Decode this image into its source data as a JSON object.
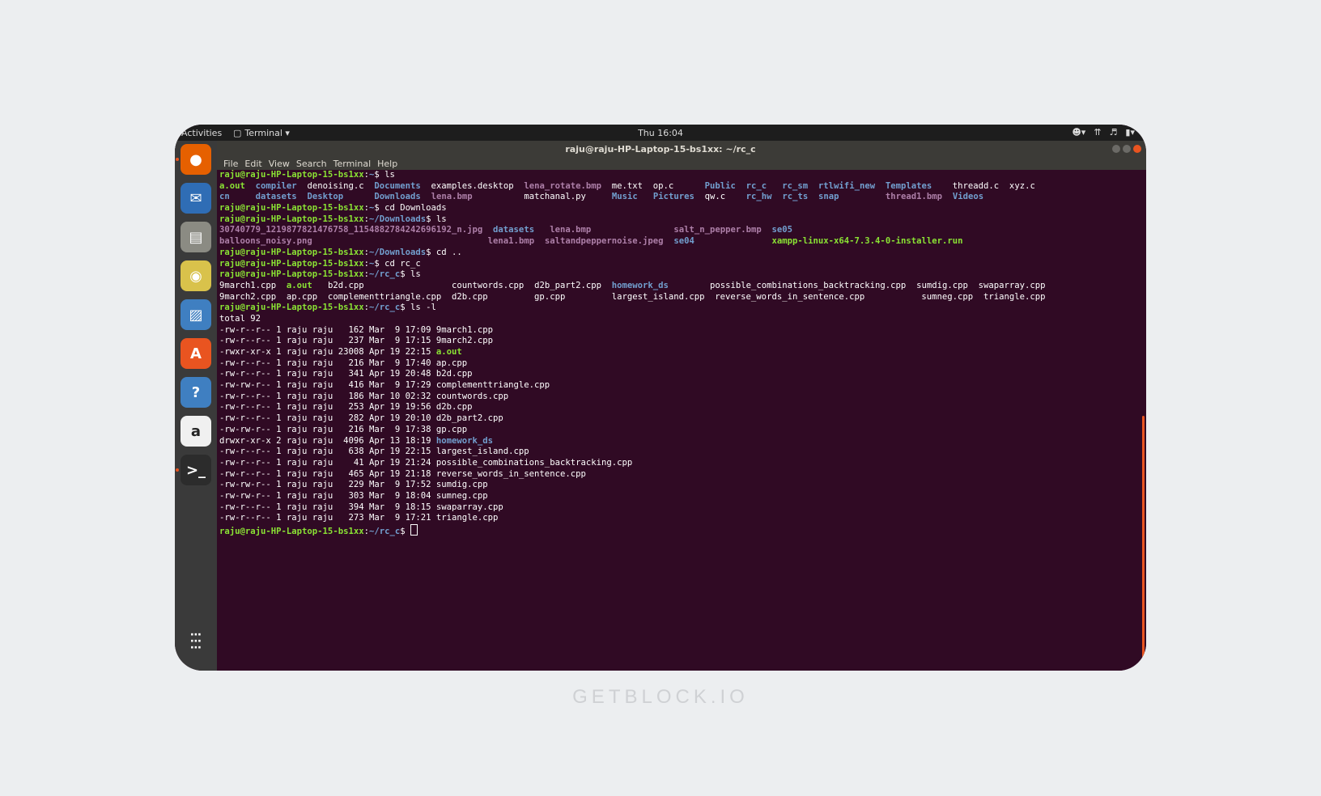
{
  "topbar": {
    "activities": "Activities",
    "app_menu": "Terminal ▾",
    "clock": "Thu 16:04"
  },
  "window": {
    "title": "raju@raju-HP-Laptop-15-bs1xx: ~/rc_c"
  },
  "menu": [
    "File",
    "Edit",
    "View",
    "Search",
    "Terminal",
    "Help"
  ],
  "dock": [
    {
      "name": "firefox-icon",
      "color": "#e66000",
      "glyph": "●"
    },
    {
      "name": "thunderbird-icon",
      "color": "#2f6db5",
      "glyph": "✉"
    },
    {
      "name": "files-icon",
      "color": "#8b8b83",
      "glyph": "▤"
    },
    {
      "name": "rhythmbox-icon",
      "color": "#d9c24b",
      "glyph": "◉"
    },
    {
      "name": "writer-icon",
      "color": "#3f7fc1",
      "glyph": "▨"
    },
    {
      "name": "software-icon",
      "color": "#e95420",
      "glyph": "A"
    },
    {
      "name": "help-icon",
      "color": "#3f7fc1",
      "glyph": "?"
    },
    {
      "name": "amazon-icon",
      "color": "#f0f0f0",
      "glyph": "a"
    },
    {
      "name": "terminal-icon",
      "color": "#2c2c2c",
      "glyph": ">_"
    }
  ],
  "terminal": [
    {
      "parts": [
        {
          "t": "raju@raju-HP-Laptop-15-bs1xx",
          "c": "prompt"
        },
        {
          "t": ":",
          "c": ""
        },
        {
          "t": "~",
          "c": "path"
        },
        {
          "t": "$ ls",
          "c": ""
        }
      ]
    },
    {
      "parts": [
        {
          "t": "a.out",
          "c": "exe"
        },
        {
          "t": "  ",
          "c": ""
        },
        {
          "t": "compiler",
          "c": "dir"
        },
        {
          "t": "  denoising.c  ",
          "c": ""
        },
        {
          "t": "Documents",
          "c": "dir"
        },
        {
          "t": "  examples.desktop  ",
          "c": ""
        },
        {
          "t": "lena_rotate.bmp",
          "c": "img"
        },
        {
          "t": "  me.txt  op.c      ",
          "c": ""
        },
        {
          "t": "Public",
          "c": "dir"
        },
        {
          "t": "  ",
          "c": ""
        },
        {
          "t": "rc_c",
          "c": "dir"
        },
        {
          "t": "   ",
          "c": ""
        },
        {
          "t": "rc_sm",
          "c": "dir"
        },
        {
          "t": "  ",
          "c": ""
        },
        {
          "t": "rtlwifi_new",
          "c": "dir"
        },
        {
          "t": "  ",
          "c": ""
        },
        {
          "t": "Templates",
          "c": "dir"
        },
        {
          "t": "    threadd.c  xyz.c",
          "c": ""
        }
      ]
    },
    {
      "parts": [
        {
          "t": "cn",
          "c": "dir"
        },
        {
          "t": "     ",
          "c": ""
        },
        {
          "t": "datasets",
          "c": "dir"
        },
        {
          "t": "  ",
          "c": ""
        },
        {
          "t": "Desktop",
          "c": "dir"
        },
        {
          "t": "      ",
          "c": ""
        },
        {
          "t": "Downloads",
          "c": "dir"
        },
        {
          "t": "  ",
          "c": ""
        },
        {
          "t": "lena.bmp",
          "c": "img"
        },
        {
          "t": "          matchanal.py     ",
          "c": ""
        },
        {
          "t": "Music",
          "c": "dir"
        },
        {
          "t": "   ",
          "c": ""
        },
        {
          "t": "Pictures",
          "c": "dir"
        },
        {
          "t": "  qw.c    ",
          "c": ""
        },
        {
          "t": "rc_hw",
          "c": "dir"
        },
        {
          "t": "  ",
          "c": ""
        },
        {
          "t": "rc_ts",
          "c": "dir"
        },
        {
          "t": "  ",
          "c": ""
        },
        {
          "t": "snap",
          "c": "dir"
        },
        {
          "t": "         ",
          "c": ""
        },
        {
          "t": "thread1.bmp",
          "c": "img"
        },
        {
          "t": "  ",
          "c": ""
        },
        {
          "t": "Videos",
          "c": "dir"
        }
      ]
    },
    {
      "parts": [
        {
          "t": "raju@raju-HP-Laptop-15-bs1xx",
          "c": "prompt"
        },
        {
          "t": ":",
          "c": ""
        },
        {
          "t": "~",
          "c": "path"
        },
        {
          "t": "$ cd Downloads",
          "c": ""
        }
      ]
    },
    {
      "parts": [
        {
          "t": "raju@raju-HP-Laptop-15-bs1xx",
          "c": "prompt"
        },
        {
          "t": ":",
          "c": ""
        },
        {
          "t": "~/Downloads",
          "c": "path"
        },
        {
          "t": "$ ls",
          "c": ""
        }
      ]
    },
    {
      "parts": [
        {
          "t": "30740779_1219877821476758_1154882784242696192_n.jpg",
          "c": "img"
        },
        {
          "t": "  ",
          "c": ""
        },
        {
          "t": "datasets",
          "c": "dir"
        },
        {
          "t": "   ",
          "c": ""
        },
        {
          "t": "lena.bmp",
          "c": "img"
        },
        {
          "t": "                ",
          "c": ""
        },
        {
          "t": "salt_n_pepper.bmp",
          "c": "img"
        },
        {
          "t": "  ",
          "c": ""
        },
        {
          "t": "se05",
          "c": "dir"
        }
      ]
    },
    {
      "parts": [
        {
          "t": "balloons_noisy.png",
          "c": "img"
        },
        {
          "t": "                                  ",
          "c": ""
        },
        {
          "t": "lena1.bmp",
          "c": "img"
        },
        {
          "t": "  ",
          "c": ""
        },
        {
          "t": "saltandpeppernoise.jpeg",
          "c": "img"
        },
        {
          "t": "  ",
          "c": ""
        },
        {
          "t": "se04",
          "c": "dir"
        },
        {
          "t": "               ",
          "c": ""
        },
        {
          "t": "xampp-linux-x64-7.3.4-0-installer.run",
          "c": "exe"
        }
      ]
    },
    {
      "parts": [
        {
          "t": "raju@raju-HP-Laptop-15-bs1xx",
          "c": "prompt"
        },
        {
          "t": ":",
          "c": ""
        },
        {
          "t": "~/Downloads",
          "c": "path"
        },
        {
          "t": "$ cd ..",
          "c": ""
        }
      ]
    },
    {
      "parts": [
        {
          "t": "raju@raju-HP-Laptop-15-bs1xx",
          "c": "prompt"
        },
        {
          "t": ":",
          "c": ""
        },
        {
          "t": "~",
          "c": "path"
        },
        {
          "t": "$ cd rc_c",
          "c": ""
        }
      ]
    },
    {
      "parts": [
        {
          "t": "raju@raju-HP-Laptop-15-bs1xx",
          "c": "prompt"
        },
        {
          "t": ":",
          "c": ""
        },
        {
          "t": "~/rc_c",
          "c": "path"
        },
        {
          "t": "$ ls",
          "c": ""
        }
      ]
    },
    {
      "parts": [
        {
          "t": "9march1.cpp  ",
          "c": ""
        },
        {
          "t": "a.out",
          "c": "exe"
        },
        {
          "t": "   b2d.cpp                 countwords.cpp  d2b_part2.cpp  ",
          "c": ""
        },
        {
          "t": "homework_ds",
          "c": "dir"
        },
        {
          "t": "        possible_combinations_backtracking.cpp  sumdig.cpp  swaparray.cpp",
          "c": ""
        }
      ]
    },
    {
      "parts": [
        {
          "t": "9march2.cpp  ap.cpp  complementtriangle.cpp  d2b.cpp         gp.cpp         largest_island.cpp  reverse_words_in_sentence.cpp           sumneg.cpp  triangle.cpp",
          "c": ""
        }
      ]
    },
    {
      "parts": [
        {
          "t": "raju@raju-HP-Laptop-15-bs1xx",
          "c": "prompt"
        },
        {
          "t": ":",
          "c": ""
        },
        {
          "t": "~/rc_c",
          "c": "path"
        },
        {
          "t": "$ ls -l",
          "c": ""
        }
      ]
    },
    {
      "parts": [
        {
          "t": "total 92",
          "c": ""
        }
      ]
    },
    {
      "parts": [
        {
          "t": "-rw-r--r-- 1 raju raju   162 Mar  9 17:09 9march1.cpp",
          "c": ""
        }
      ]
    },
    {
      "parts": [
        {
          "t": "-rw-r--r-- 1 raju raju   237 Mar  9 17:15 9march2.cpp",
          "c": ""
        }
      ]
    },
    {
      "parts": [
        {
          "t": "-rwxr-xr-x 1 raju raju 23008 Apr 19 22:15 ",
          "c": ""
        },
        {
          "t": "a.out",
          "c": "exe"
        }
      ]
    },
    {
      "parts": [
        {
          "t": "-rw-r--r-- 1 raju raju   216 Mar  9 17:40 ap.cpp",
          "c": ""
        }
      ]
    },
    {
      "parts": [
        {
          "t": "-rw-r--r-- 1 raju raju   341 Apr 19 20:48 b2d.cpp",
          "c": ""
        }
      ]
    },
    {
      "parts": [
        {
          "t": "-rw-rw-r-- 1 raju raju   416 Mar  9 17:29 complementtriangle.cpp",
          "c": ""
        }
      ]
    },
    {
      "parts": [
        {
          "t": "-rw-r--r-- 1 raju raju   186 Mar 10 02:32 countwords.cpp",
          "c": ""
        }
      ]
    },
    {
      "parts": [
        {
          "t": "-rw-r--r-- 1 raju raju   253 Apr 19 19:56 d2b.cpp",
          "c": ""
        }
      ]
    },
    {
      "parts": [
        {
          "t": "-rw-r--r-- 1 raju raju   282 Apr 19 20:10 d2b_part2.cpp",
          "c": ""
        }
      ]
    },
    {
      "parts": [
        {
          "t": "-rw-rw-r-- 1 raju raju   216 Mar  9 17:38 gp.cpp",
          "c": ""
        }
      ]
    },
    {
      "parts": [
        {
          "t": "drwxr-xr-x 2 raju raju  4096 Apr 13 18:19 ",
          "c": ""
        },
        {
          "t": "homework_ds",
          "c": "dir"
        }
      ]
    },
    {
      "parts": [
        {
          "t": "-rw-r--r-- 1 raju raju   638 Apr 19 22:15 largest_island.cpp",
          "c": ""
        }
      ]
    },
    {
      "parts": [
        {
          "t": "-rw-r--r-- 1 raju raju    41 Apr 19 21:24 possible_combinations_backtracking.cpp",
          "c": ""
        }
      ]
    },
    {
      "parts": [
        {
          "t": "-rw-r--r-- 1 raju raju   465 Apr 19 21:18 reverse_words_in_sentence.cpp",
          "c": ""
        }
      ]
    },
    {
      "parts": [
        {
          "t": "-rw-rw-r-- 1 raju raju   229 Mar  9 17:52 sumdig.cpp",
          "c": ""
        }
      ]
    },
    {
      "parts": [
        {
          "t": "-rw-rw-r-- 1 raju raju   303 Mar  9 18:04 sumneg.cpp",
          "c": ""
        }
      ]
    },
    {
      "parts": [
        {
          "t": "-rw-r--r-- 1 raju raju   394 Mar  9 18:15 swaparray.cpp",
          "c": ""
        }
      ]
    },
    {
      "parts": [
        {
          "t": "-rw-r--r-- 1 raju raju   273 Mar  9 17:21 triangle.cpp",
          "c": ""
        }
      ]
    },
    {
      "parts": [
        {
          "t": "raju@raju-HP-Laptop-15-bs1xx",
          "c": "prompt"
        },
        {
          "t": ":",
          "c": ""
        },
        {
          "t": "~/rc_c",
          "c": "path"
        },
        {
          "t": "$ ",
          "c": ""
        }
      ],
      "cursor": true
    }
  ],
  "watermark": "GETBLOCK.IO"
}
